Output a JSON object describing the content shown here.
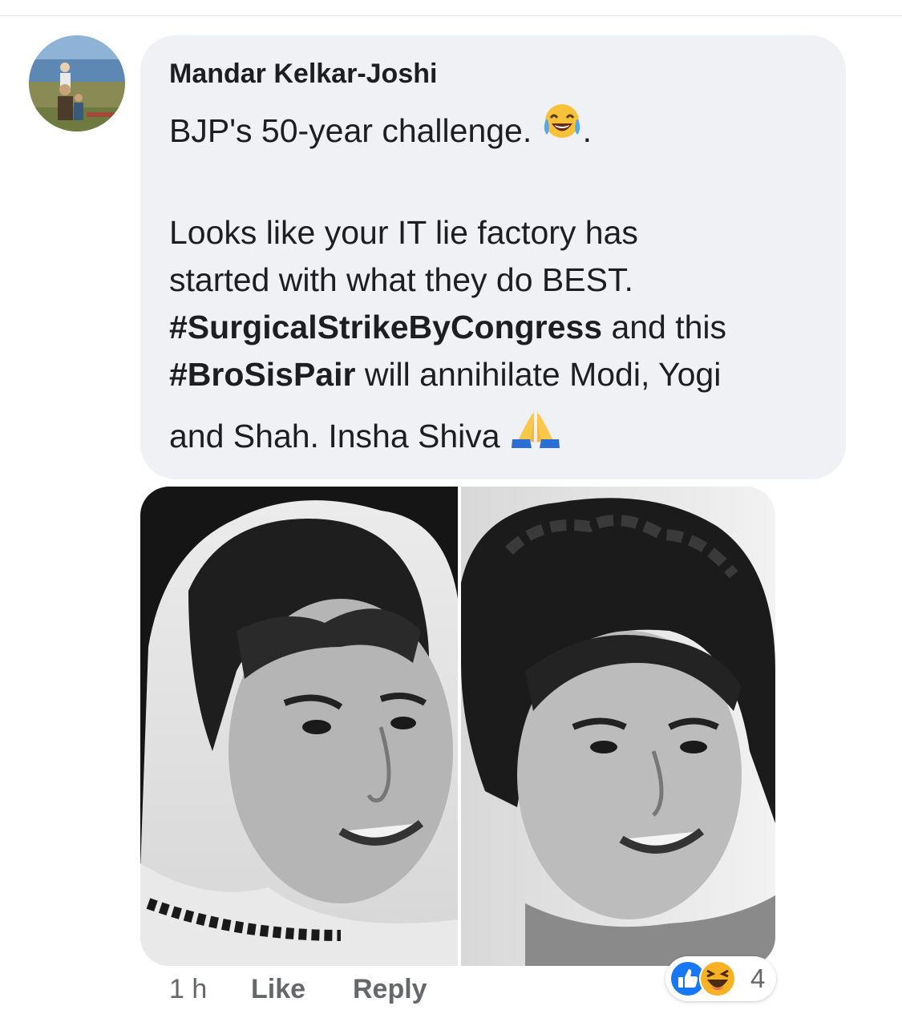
{
  "comment": {
    "author": "Mandar Kelkar-Joshi",
    "lines": {
      "l1_text": "BJP's 50-year challenge. ",
      "l1_suffix": ".",
      "l2": "Looks like your IT lie factory has",
      "l3": "started with what they do BEST.",
      "l4_hashtag": "#SurgicalStrikeByCongress",
      "l4_rest": " and this",
      "l5_hashtag": "#BroSisPair",
      "l5_rest": " will annihilate Modi, Yogi",
      "l6_text": "and Shah. Insha Shiva "
    },
    "inline_emojis": [
      "tears-of-joy-emoji",
      "folded-hands-emoji"
    ]
  },
  "footer": {
    "timestamp": "1 h",
    "like_label": "Like",
    "reply_label": "Reply"
  },
  "reactions": {
    "types": [
      "like",
      "haha"
    ],
    "count": "4",
    "colors": {
      "like": "#1877f2",
      "haha": "#f7b125"
    }
  },
  "colors": {
    "bubble_bg": "#f0f1f4",
    "text": "#1c1e21",
    "secondary_text": "#65676b"
  }
}
